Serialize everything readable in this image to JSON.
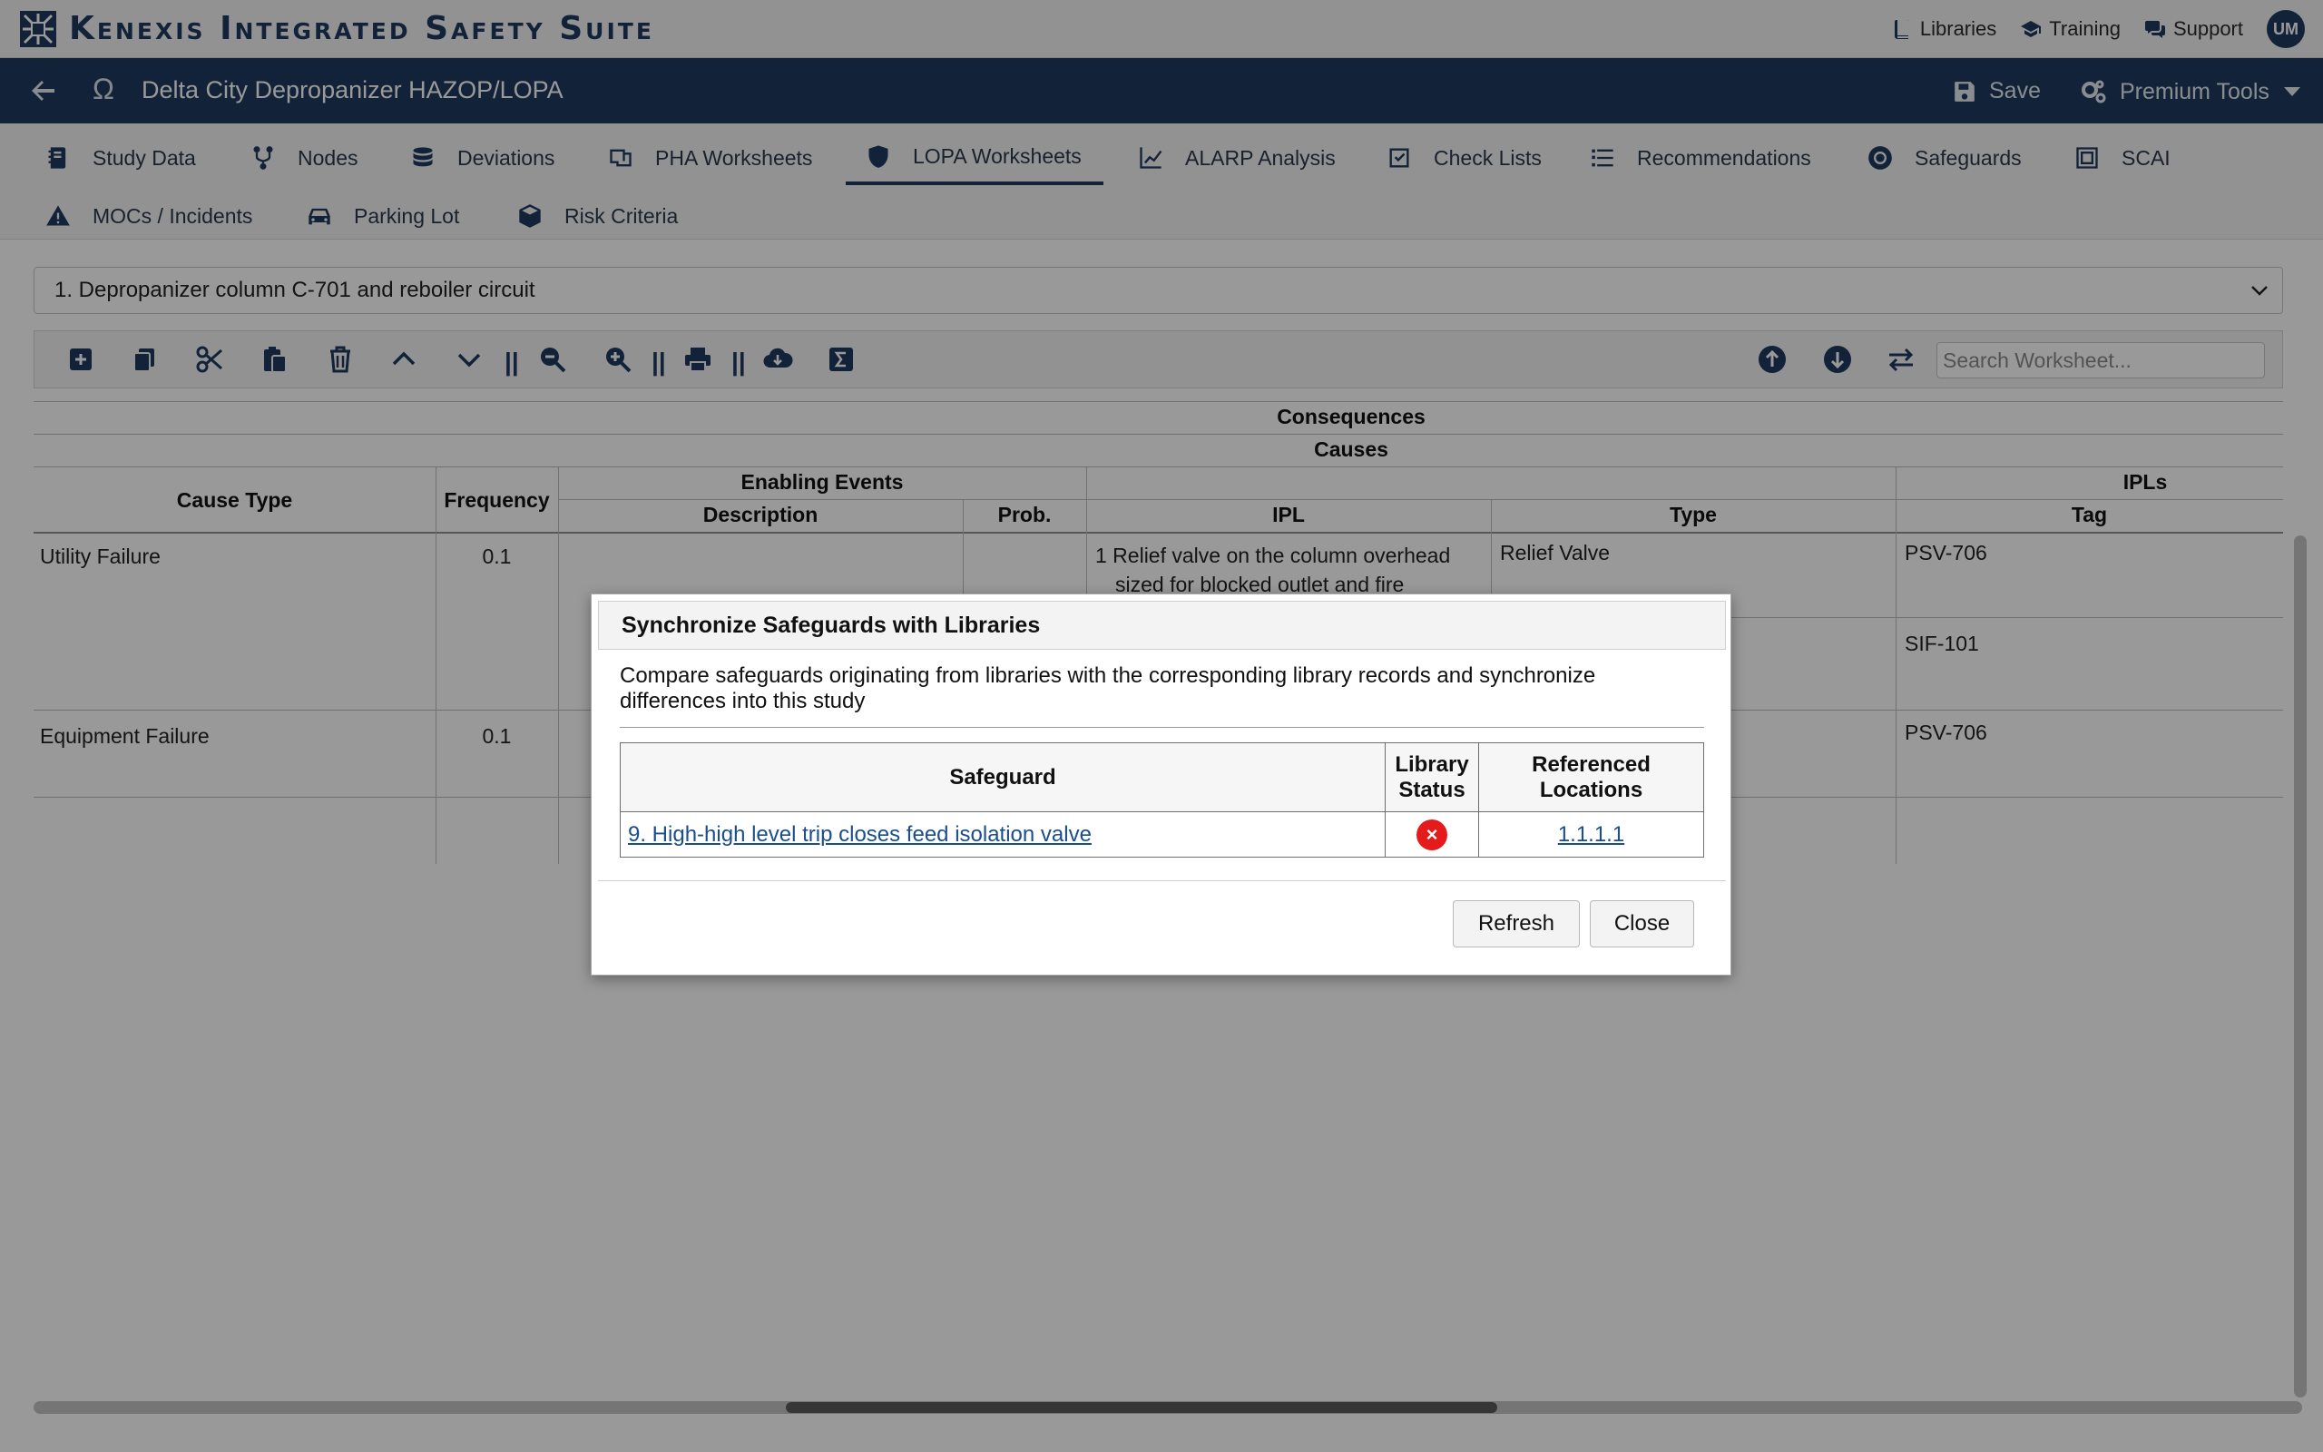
{
  "app": {
    "title": "Kenexis Integrated Safety Suite",
    "brand_color": "#1e3a5f"
  },
  "topnav": {
    "libraries": "Libraries",
    "training": "Training",
    "support": "Support",
    "avatar": "UM"
  },
  "study": {
    "omega": "Ω",
    "title": "Delta City Depropanizer HAZOP/LOPA",
    "save": "Save",
    "premium": "Premium Tools"
  },
  "tabs": [
    {
      "label": "Study Data",
      "icon": "study-data-icon"
    },
    {
      "label": "Nodes",
      "icon": "nodes-icon"
    },
    {
      "label": "Deviations",
      "icon": "database-icon"
    },
    {
      "label": "PHA Worksheets",
      "icon": "worksheet-icon"
    },
    {
      "label": "LOPA Worksheets",
      "icon": "shield-icon",
      "active": true
    },
    {
      "label": "ALARP Analysis",
      "icon": "chart-line-icon"
    },
    {
      "label": "Check Lists",
      "icon": "checkbox-icon"
    },
    {
      "label": "Recommendations",
      "icon": "list-icon"
    },
    {
      "label": "Safeguards",
      "icon": "lifering-icon"
    },
    {
      "label": "SCAI",
      "icon": "scai-icon"
    },
    {
      "label": "MOCs / Incidents",
      "icon": "warning-icon"
    },
    {
      "label": "Parking Lot",
      "icon": "car-icon"
    },
    {
      "label": "Risk Criteria",
      "icon": "cube-icon"
    }
  ],
  "node_select": {
    "value": "1. Depropanizer column C-701 and reboiler circuit"
  },
  "toolbar": {
    "search_placeholder": "Search Worksheet...",
    "separator": "||"
  },
  "sheet": {
    "headers": {
      "consequences": "Consequences",
      "causes": "Causes",
      "cause_type": "Cause Type",
      "frequency": "Frequency",
      "enabling_events": "Enabling Events",
      "description": "Description",
      "prob": "Prob.",
      "ipl": "IPL",
      "type": "Type",
      "ipls": "IPLs",
      "tag": "Tag"
    },
    "rows": [
      {
        "cause_type": "Utility Failure",
        "frequency": "0.1",
        "ipl": "1 Relief valve on the column overhead sized for blocked outlet and fire",
        "type": "Relief Valve",
        "tag": "PSV-706",
        "tag2": "SIF-101"
      },
      {
        "cause_type": "Equipment Failure",
        "frequency": "0.1",
        "tag": "PSV-706"
      }
    ]
  },
  "dialog": {
    "title": "Synchronize Safeguards with Libraries",
    "description": "Compare safeguards originating from libraries with the corresponding library records and synchronize differences into this study",
    "col_safeguard": "Safeguard",
    "col_status_1": "Library",
    "col_status_2": "Status",
    "col_locations_1": "Referenced",
    "col_locations_2": "Locations",
    "rows": [
      {
        "safeguard": "9. High-high level trip closes feed isolation valve",
        "status": "error",
        "location": "1.1.1.1"
      }
    ],
    "status_glyph": "×",
    "refresh": "Refresh",
    "close": "Close"
  }
}
